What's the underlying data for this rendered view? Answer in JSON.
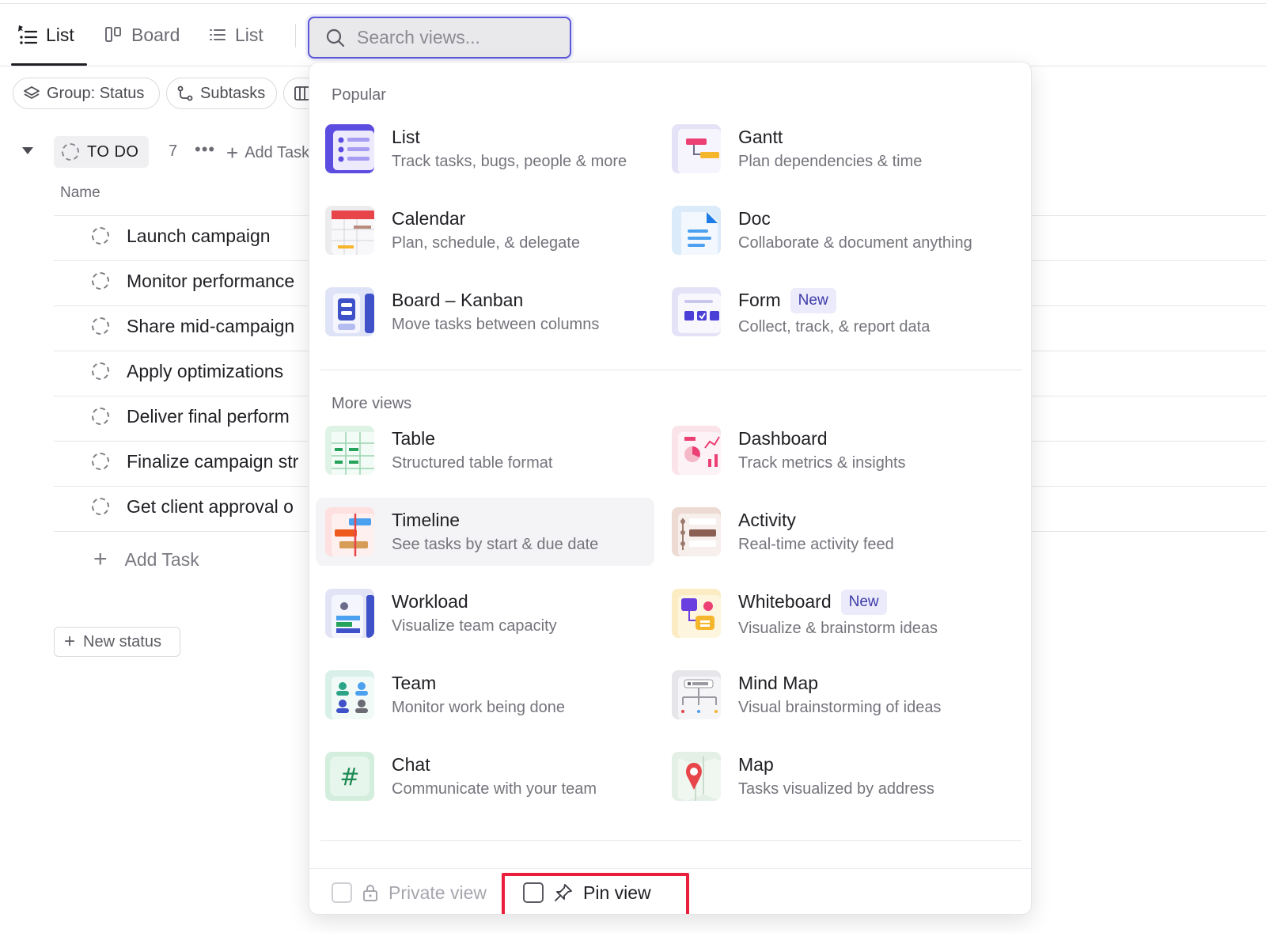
{
  "tabs": [
    {
      "label": "List",
      "icon": "list-icon",
      "active": true
    },
    {
      "label": "Board",
      "icon": "board-icon",
      "active": false
    },
    {
      "label": "List",
      "icon": "list-icon",
      "active": false
    }
  ],
  "search": {
    "placeholder": "Search views..."
  },
  "toolbar": {
    "group_label": "Group: Status",
    "subtasks_label": "Subtasks"
  },
  "group": {
    "status": "TO DO",
    "count": "7",
    "add_task": "Add Task"
  },
  "table": {
    "name_header": "Name",
    "tasks": [
      "Launch campaign",
      "Monitor performance",
      "Share mid-campaign",
      "Apply optimizations",
      "Deliver final perform",
      "Finalize campaign str",
      "Get client approval o"
    ],
    "add_task": "Add Task",
    "new_status": "New status"
  },
  "dropdown": {
    "popular_heading": "Popular",
    "more_heading": "More views",
    "popular": [
      {
        "title": "List",
        "desc": "Track tasks, bugs, people & more",
        "icon": "list-view-icon"
      },
      {
        "title": "Gantt",
        "desc": "Plan dependencies & time",
        "icon": "gantt-view-icon"
      },
      {
        "title": "Calendar",
        "desc": "Plan, schedule, & delegate",
        "icon": "calendar-view-icon"
      },
      {
        "title": "Doc",
        "desc": "Collaborate & document anything",
        "icon": "doc-view-icon"
      },
      {
        "title": "Board – Kanban",
        "desc": "Move tasks between columns",
        "icon": "board-view-icon"
      },
      {
        "title": "Form",
        "desc": "Collect, track, & report data",
        "badge": "New",
        "icon": "form-view-icon"
      }
    ],
    "more": [
      {
        "title": "Table",
        "desc": "Structured table format",
        "icon": "table-view-icon"
      },
      {
        "title": "Dashboard",
        "desc": "Track metrics & insights",
        "icon": "dashboard-view-icon"
      },
      {
        "title": "Timeline",
        "desc": "See tasks by start & due date",
        "icon": "timeline-view-icon"
      },
      {
        "title": "Activity",
        "desc": "Real-time activity feed",
        "icon": "activity-view-icon"
      },
      {
        "title": "Workload",
        "desc": "Visualize team capacity",
        "icon": "workload-view-icon"
      },
      {
        "title": "Whiteboard",
        "desc": "Visualize & brainstorm ideas",
        "badge": "New",
        "icon": "whiteboard-view-icon"
      },
      {
        "title": "Team",
        "desc": "Monitor work being done",
        "icon": "team-view-icon"
      },
      {
        "title": "Mind Map",
        "desc": "Visual brainstorming of ideas",
        "icon": "mindmap-view-icon"
      },
      {
        "title": "Chat",
        "desc": "Communicate with your team",
        "icon": "chat-view-icon"
      },
      {
        "title": "Map",
        "desc": "Tasks visualized by address",
        "icon": "map-view-icon"
      }
    ],
    "footer": {
      "private_label": "Private view",
      "pin_label": "Pin view"
    }
  },
  "colors": {
    "accent": "#5b57d9",
    "highlight": "#ea1f3c"
  }
}
